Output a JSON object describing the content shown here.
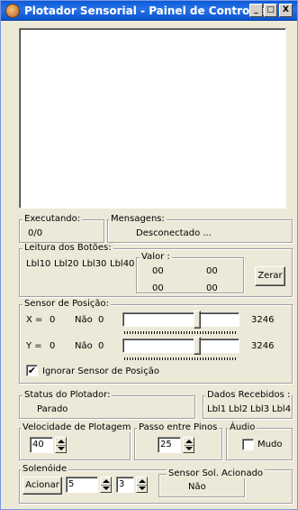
{
  "window": {
    "title": "Plotador Sensorial - Painel de Controles"
  },
  "titlebar_buttons": {
    "minimize": "_",
    "maximize": "□",
    "close": "X"
  },
  "executando": {
    "legend": "Executando:",
    "value": "0/0"
  },
  "mensagens": {
    "legend": "Mensagens:",
    "value": "Desconectado ..."
  },
  "leitura": {
    "legend": "Leitura dos Botões:",
    "labels": [
      "Lbl10",
      "Lbl20",
      "Lbl30",
      "Lbl40"
    ],
    "valor_legend": "Valor :",
    "values": [
      "00",
      "00",
      "00",
      "00"
    ],
    "zerar_label": "Zerar"
  },
  "sensor": {
    "legend": "Sensor de Posição:",
    "x": {
      "label": "X =",
      "value": "0",
      "nao_label": "Não",
      "nao_value": "0",
      "reading": "3246",
      "level": 0.65
    },
    "y": {
      "label": "Y =",
      "value": "0",
      "nao_label": "Não",
      "nao_value": "0",
      "reading": "3246",
      "level": 0.65
    },
    "ignore_checkbox": {
      "label": "Ignorar Sensor de Posição",
      "checked": true,
      "mark": "✔"
    }
  },
  "status": {
    "legend": "Status do Plotador:",
    "value": "Parado"
  },
  "dados": {
    "legend": "Dados Recebidos :",
    "labels": [
      "Lbl1",
      "Lbl2",
      "Lbl3",
      "Lbl4"
    ]
  },
  "velocidade": {
    "legend": "Velocidade de Plotagem",
    "value": "40"
  },
  "passo": {
    "legend": "Passo entre Pinos",
    "value": "25"
  },
  "audio": {
    "legend": "Áudio",
    "mudo_label": "Mudo",
    "checked": false
  },
  "solenoide": {
    "legend": "Solenóide",
    "acionar_label": "Acionar",
    "value1": "5",
    "value2": "3",
    "sensor_legend": "Sensor Sol. Acionado",
    "sensor_value": "Não"
  }
}
